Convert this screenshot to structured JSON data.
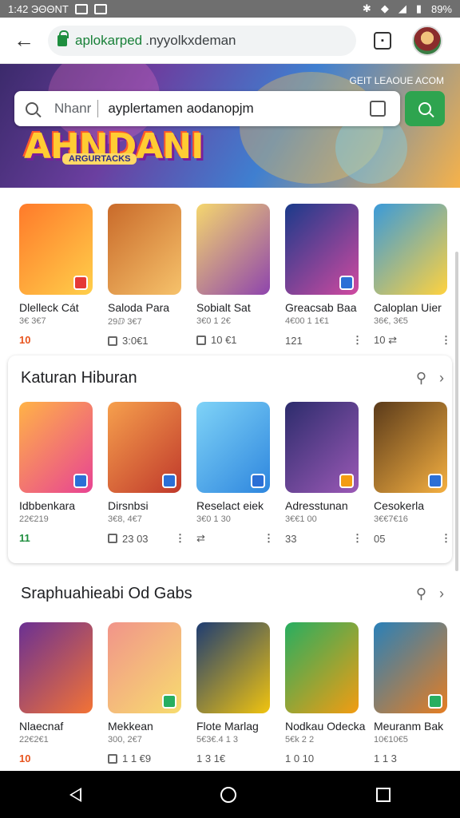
{
  "status_bar": {
    "time": "1:42 ЭΘΘΝΤ",
    "battery": "89%"
  },
  "browser": {
    "url_host": "aplokarped",
    "url_path": ".nyyolkxdeman",
    "avatar": "user-avatar"
  },
  "banner": {
    "logo": "AHNDANI",
    "sub": "ARGURTACKS",
    "corner_text": "GEIT LEAOUE ACOM",
    "search": {
      "prefix": "Nhanr",
      "text": "ayplertamen aodanopjm"
    }
  },
  "colors": {
    "accent_green": "#2ea44f",
    "accent_red": "#e8541e"
  },
  "sections": [
    {
      "title": "",
      "apps": [
        {
          "name": "Dlelleck Cát",
          "meta": "3€ 3€7",
          "stat": "10",
          "stat_style": "red"
        },
        {
          "name": "Saloda Para",
          "meta": "29ⅅ 3€7",
          "stat": "3:0€1",
          "stat_style": "plain"
        },
        {
          "name": "Sobialt Sat",
          "meta": "3€0 1 2€",
          "stat": "10 €1",
          "stat_style": "plain"
        },
        {
          "name": "Greacsab Baa",
          "meta": "4€00 1 1€1",
          "stat": "121",
          "stat_style": "plain"
        },
        {
          "name": "Caloplan Uier",
          "meta": "36€, 3€5",
          "stat": "10 ⇄",
          "stat_style": "plain"
        }
      ]
    },
    {
      "title": "Katuran Hiburan",
      "apps": [
        {
          "name": "Idbbenkara",
          "meta": "22€219",
          "stat": "11",
          "stat_style": "green"
        },
        {
          "name": "Dirsnbsi",
          "meta": "3€8, 4€7",
          "stat": "23 03",
          "stat_style": "plain"
        },
        {
          "name": "Reselact eiek",
          "meta": "3€0 1 30",
          "stat": "⇄",
          "stat_style": "plain"
        },
        {
          "name": "Adresstunan",
          "meta": "3€€1 00",
          "stat": "33",
          "stat_style": "plain"
        },
        {
          "name": "Cesokerla",
          "meta": "3€€7€16",
          "stat": "05",
          "stat_style": "plain"
        }
      ]
    },
    {
      "title": "Sraphuahieabi Od Gabs",
      "apps": [
        {
          "name": "Nlaecnaf",
          "meta": "22€2€1",
          "stat": "10",
          "stat_style": "red"
        },
        {
          "name": "Mekkean",
          "meta": "300, 2€7",
          "stat": "1 1 €9",
          "stat_style": "plain"
        },
        {
          "name": "Flote Marlag",
          "meta": "5€3€.4 1 3",
          "stat": "1 3 1€",
          "stat_style": "plain"
        },
        {
          "name": "Nodkau Odecka",
          "meta": "5€k 2 2",
          "stat": "1 0 10",
          "stat_style": "plain"
        },
        {
          "name": "Meuranm Bak",
          "meta": "10€10€5",
          "stat": "1 1 3",
          "stat_style": "plain"
        }
      ]
    }
  ]
}
